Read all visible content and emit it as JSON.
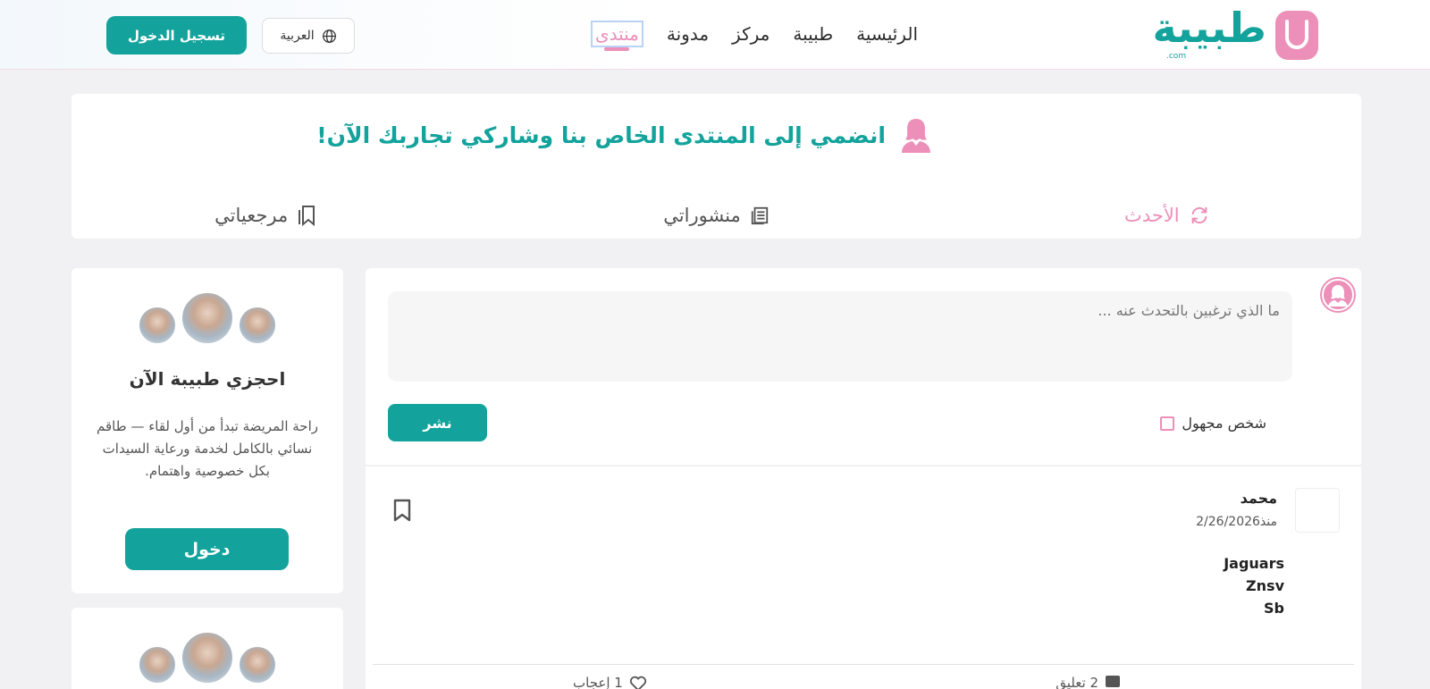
{
  "header": {
    "logo_text": "طبيبة",
    "logo_suffix": ".com",
    "nav": [
      {
        "label": "الرئيسية",
        "active": false
      },
      {
        "label": "طبيبة",
        "active": false
      },
      {
        "label": "مركز",
        "active": false
      },
      {
        "label": "مدونة",
        "active": false
      },
      {
        "label": "منتدى",
        "active": true
      }
    ],
    "language": "العربية",
    "login": "تسجيل الدخول"
  },
  "banner": {
    "title": "انضمي إلى المنتدى الخاص بنا وشاركي تجاربك الآن!",
    "tabs": [
      {
        "label": "الأحدث",
        "icon": "refresh-icon",
        "active": true
      },
      {
        "label": "منشوراتي",
        "icon": "document-icon",
        "active": false
      },
      {
        "label": "مرجعياتي",
        "icon": "bookmark-icon",
        "active": false
      }
    ]
  },
  "sidebar": {
    "card_title": "احجزي طبيبة الآن",
    "card_desc": "راحة المريضة تبدأ من أول لقاء — طاقم نسائي بالكامل لخدمة ورعاية السيدات بكل خصوصية واهتمام.",
    "card_button": "دخول"
  },
  "compose": {
    "placeholder": "ما الذي ترغبين بالتحدث عنه ...",
    "anonymous_label": "شخص مجهول",
    "publish_label": "نشر"
  },
  "post": {
    "author": "محمد",
    "date": "منذ2/26/2026",
    "lines": [
      "Jaguars",
      "Znsv",
      "Sb"
    ],
    "comments_label": "2 تعليق",
    "likes_label": "1 إعجاب"
  },
  "colors": {
    "brand_teal": "#13a39c",
    "brand_pink": "#ec8fb9"
  }
}
